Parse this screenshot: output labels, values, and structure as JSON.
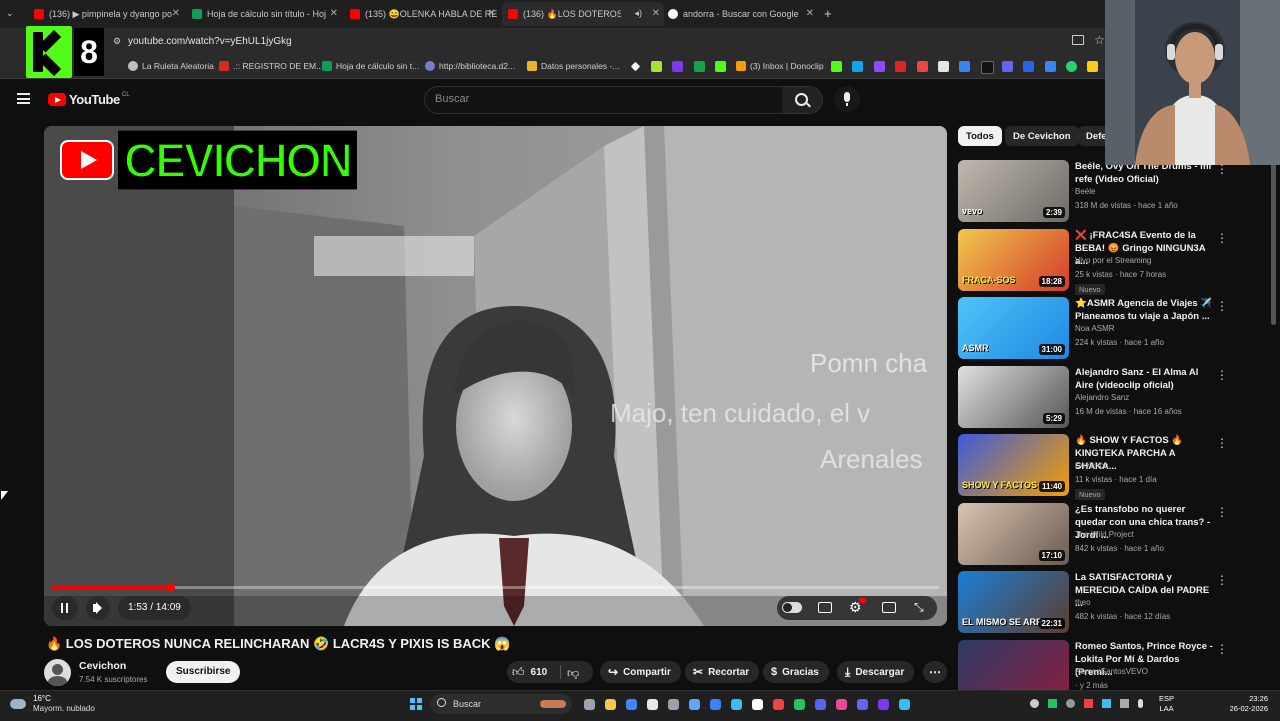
{
  "browser": {
    "tabs": [
      {
        "label": "(136) ▶ pimpinela y dyango po",
        "color": "#ff0000"
      },
      {
        "label": "Hoja de cálculo sin título - Hoj",
        "color": "#0f9d58"
      },
      {
        "label": "(135) 😄OLENKA HABLA DE RE",
        "color": "#ff0000"
      },
      {
        "label": "(136) 🔥LOS DOTEROS NU",
        "color": "#ff0000"
      },
      {
        "label": "andorra - Buscar con Google",
        "color": "#4285f4"
      }
    ],
    "url": "youtube.com/watch?v=yEhUL1jyGkg",
    "bookmarks": [
      "La Ruleta Aleatoria",
      ".:: REGISTRO DE EM...",
      "Hoja de cálculo sin t...",
      "http://biblioteca.d2...",
      "Datos personales -...",
      "(3) Inbox | Donoclip"
    ]
  },
  "overlay_logo": {
    "letter": "K",
    "number": "8"
  },
  "youtube": {
    "logo_text": "YouTube",
    "region": "CL",
    "search_placeholder": "Buscar"
  },
  "player": {
    "channel_banner": "CEVICHON",
    "subtitle_lines": [
      "Pomn cha",
      "Majo, ten cuidado, el v",
      "Arenales"
    ],
    "time_display": "1:53 / 14:09",
    "progress_fraction": 0.134
  },
  "video": {
    "title": "🔥 LOS DOTEROS NUNCA RELINCHARAN 🤣 LACR4S Y PIXIS IS BACK 😱",
    "channel": "Cevichon",
    "subscribers": "7.54 K suscriptores",
    "subscribe_label": "Suscribirse",
    "likes": "610",
    "share_label": "Compartir",
    "clip_label": "Recortar",
    "thanks_label": "Gracias",
    "download_label": "Descargar"
  },
  "chips": [
    "Todos",
    "De Cevichon",
    "Defe"
  ],
  "recommendations": [
    {
      "title": "Beéle, Ovy On The Drums - mi refe (Video Oficial)",
      "channel": "Beéle",
      "views": "318 M de vistas · hace 1 año",
      "duration": "2:39",
      "badge": ""
    },
    {
      "title": "❌ ¡FRAC4SA Evento de la BEBA! 😡 Gringo NINGUN3A a...",
      "channel": "Vivo por el Streaming",
      "views": "25 k vistas · hace 7 horas",
      "duration": "18:28",
      "badge": "Nuevo"
    },
    {
      "title": "⭐ASMR Agencia de Viajes ✈️ Planeamos tu viaje a Japón ...",
      "channel": "Noa ASMR",
      "views": "224 k vistas · hace 1 año",
      "duration": "31:00",
      "badge": ""
    },
    {
      "title": "Alejandro Sanz - El Alma Al Aire (videoclip oficial)",
      "channel": "Alejandro Sanz",
      "views": "16 M de vistas · hace 16 años",
      "duration": "5:29",
      "badge": ""
    },
    {
      "title": "🔥 SHOW Y FACTOS 🔥 KINGTEKA PARCHA A SHAKA...",
      "channel": "Cevichon",
      "views": "11 k vistas · hace 1 día",
      "duration": "11:40",
      "badge": "Nuevo"
    },
    {
      "title": "¿Es transfobo no querer quedar con una chica trans? - Jordi ...",
      "channel": "The Wild Project",
      "views": "842 k vistas · hace 1 año",
      "duration": "17:10",
      "badge": ""
    },
    {
      "title": "La SATISFACTORIA y MERECIDA CAÍDA del PADRE ...",
      "channel": "theo",
      "views": "482 k vistas · hace 12 días",
      "duration": "22:31",
      "badge": ""
    },
    {
      "title": "Romeo Santos, Prince Royce - Lokita Por Mí & Dardos (Premi...",
      "channel": "RomeoSantosVEVO",
      "views": "· y 2 más",
      "duration": "",
      "badge": ""
    }
  ],
  "thumb_texts": [
    "vevo",
    "FRACA-SOS",
    "ASMR",
    "",
    "SHOW Y FACTOS",
    "",
    "EL MISMO SE ARR",
    ""
  ],
  "taskbar": {
    "weather_temp": "16°C",
    "weather_desc": "Mayorm. nublado",
    "search_label": "Buscar",
    "lang1": "ESP",
    "lang2": "LAA",
    "time": "23:26",
    "date": "26-02-2026"
  }
}
